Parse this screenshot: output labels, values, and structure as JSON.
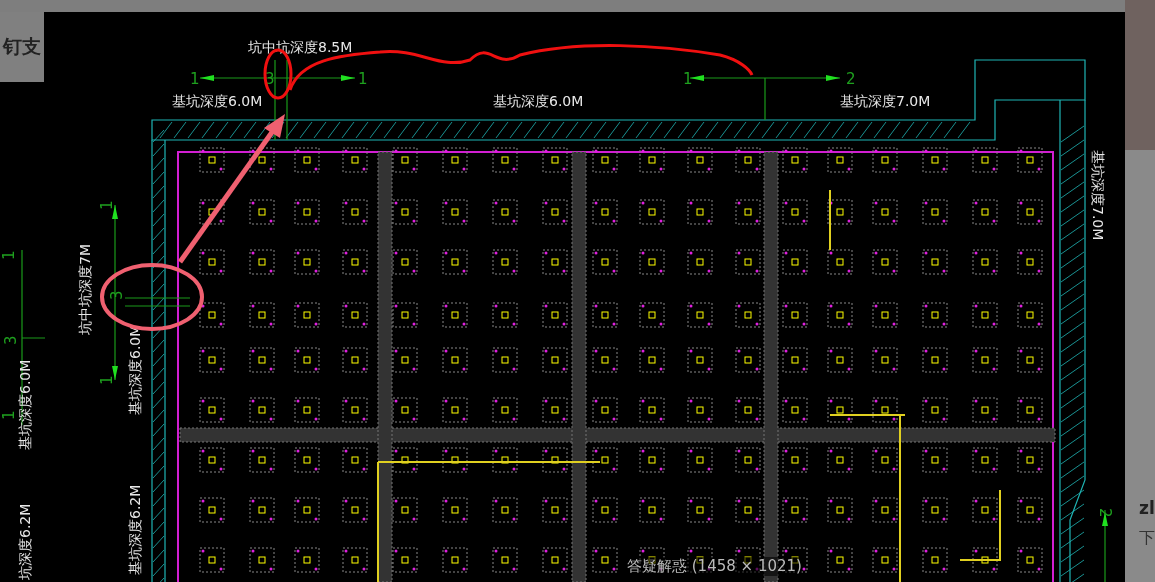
{
  "page": {
    "heading_fragment": "钉支",
    "side_texts": [
      "zl",
      "下"
    ]
  },
  "viewer": {
    "caption": "答疑解惑 (1458 × 1021)",
    "drawing": {
      "depth_labels": [
        "坑中坑深度8.5M",
        "基坑深度6.0M",
        "基坑深度6.0M",
        "基坑深度7.0M",
        "基坑深度7.0M",
        "坑中坑深度7M",
        "基坑深度6.0M",
        "基坑深度6.0M",
        "基坑深度6.2M",
        "坑深度6.2M"
      ],
      "axis_numbers": [
        "1",
        "3",
        "1",
        "1",
        "2",
        "1",
        "3",
        "1",
        "1",
        "3",
        "1",
        "2"
      ]
    }
  }
}
